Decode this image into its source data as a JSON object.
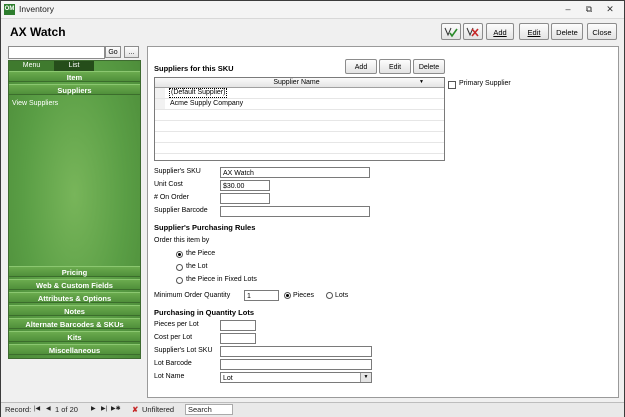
{
  "window": {
    "app_icon": "OM",
    "title": "Inventory"
  },
  "header": {
    "title": "AX Watch"
  },
  "toolbar": {
    "add": "Add",
    "edit": "Edit",
    "delete": "Delete",
    "close": "Close"
  },
  "search": {
    "go": "Go",
    "more": "..."
  },
  "left": {
    "tabs": [
      "Menu",
      "List"
    ],
    "sections_top": [
      "Item",
      "Suppliers"
    ],
    "active_item": "View Suppliers",
    "sections_bottom": [
      "Pricing",
      "Web & Custom Fields",
      "Attributes & Options",
      "Notes",
      "Alternate Barcodes & SKUs",
      "Kits",
      "Miscellaneous"
    ]
  },
  "suppliers": {
    "section_title": "Suppliers for this SKU",
    "add": "Add",
    "edit": "Edit",
    "delete": "Delete",
    "column": "Supplier Name",
    "rows": [
      "(Default Supplier)",
      "Acme Supply Company"
    ],
    "primary_label": "Primary Supplier"
  },
  "fields": {
    "sku_label": "Supplier's SKU",
    "sku_value": "AX Watch",
    "cost_label": "Unit Cost",
    "cost_value": "$30.00",
    "onorder_label": "# On Order",
    "onorder_value": "",
    "barcode_label": "Supplier Barcode",
    "barcode_value": ""
  },
  "rules": {
    "title": "Supplier's Purchasing Rules",
    "order_by": "Order this item by",
    "options": [
      "the Piece",
      "the Lot",
      "the Piece in Fixed Lots"
    ],
    "min_label": "Minimum Order Quantity",
    "min_value": "1",
    "pieces": "Pieces",
    "lots": "Lots"
  },
  "lots": {
    "title": "Purchasing in Quantity Lots",
    "per_lot": "Pieces per Lot",
    "cost_per_lot": "Cost per Lot",
    "lot_sku": "Supplier's Lot SKU",
    "lot_barcode": "Lot Barcode",
    "lot_name": "Lot Name",
    "lot_name_value": "Lot"
  },
  "status": {
    "record": "Record:",
    "position": "1 of 20",
    "filter": "Unfiltered",
    "search": "Search"
  }
}
